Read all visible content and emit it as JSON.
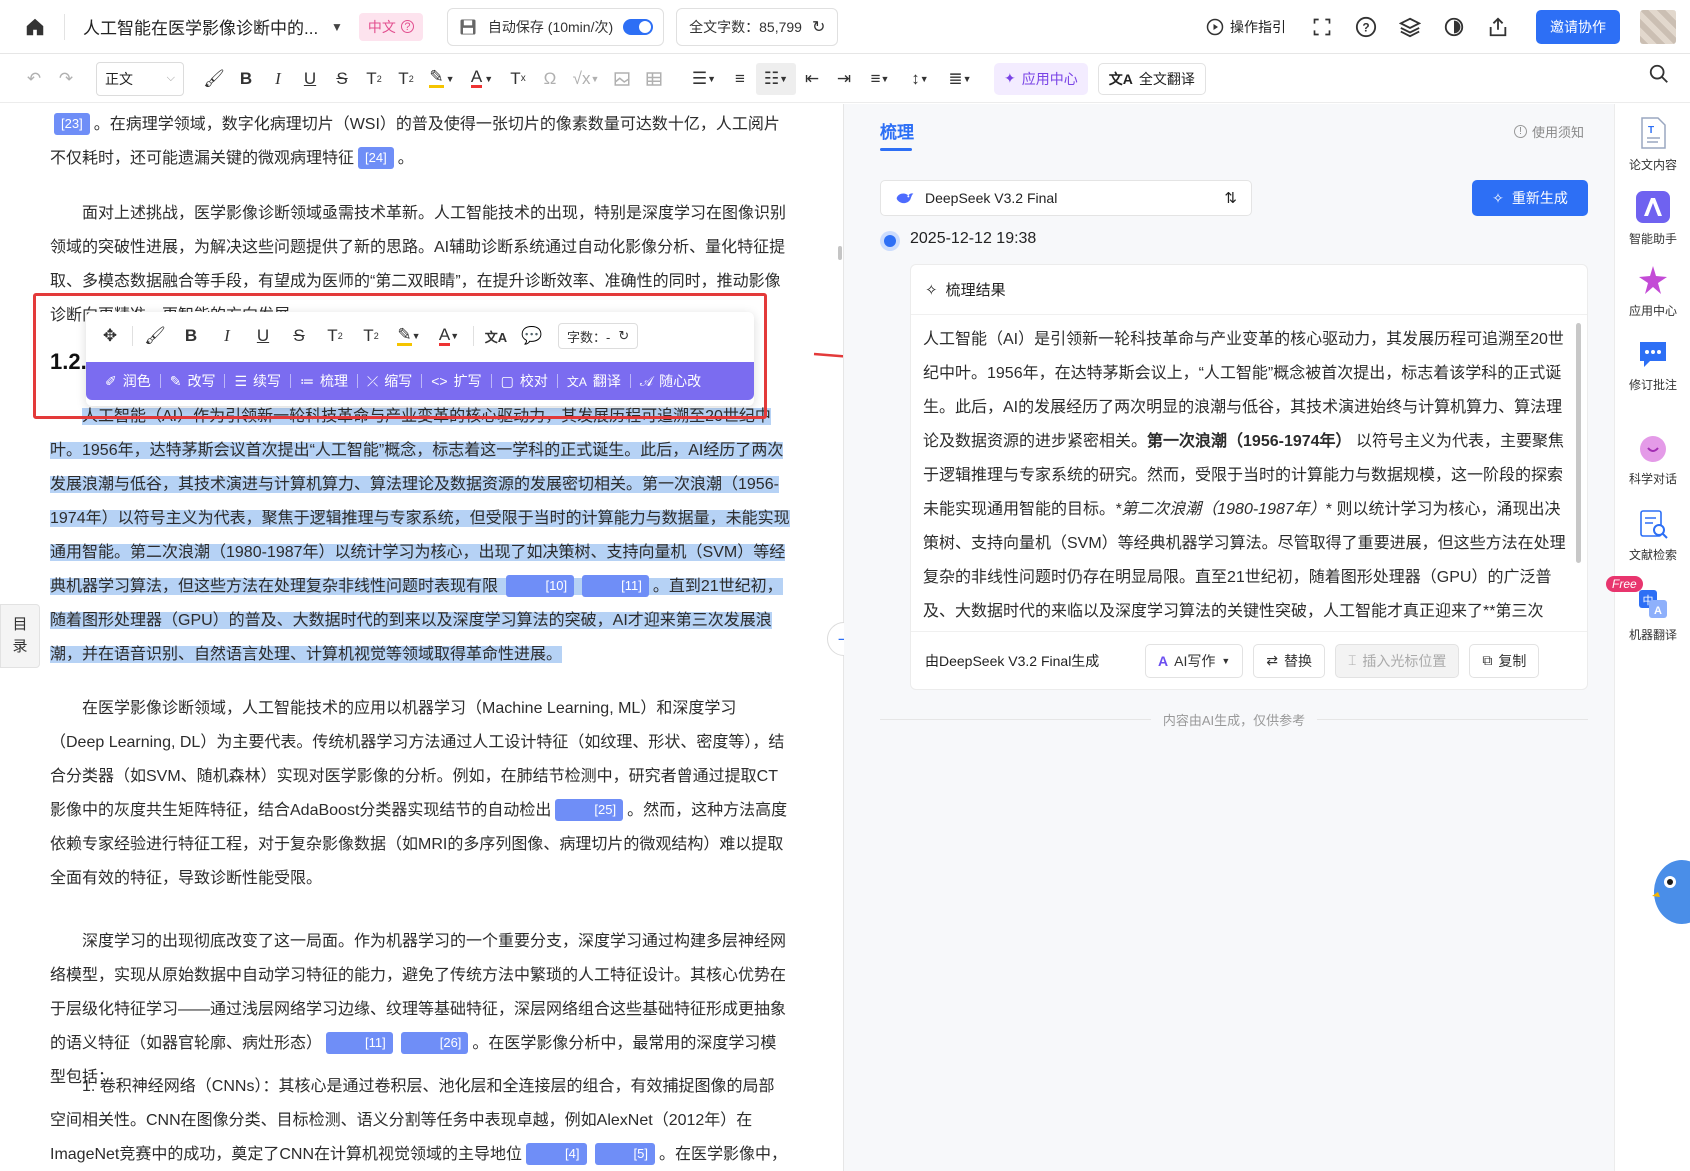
{
  "app": {
    "doc_title": "人工智能在医学影像诊断中的...",
    "lang_badge": "中文",
    "autosave_label": "自动保存 (10min/次)",
    "word_count": "全文字数：85,799",
    "guide": "操作指引",
    "invite": "邀请协作"
  },
  "toolbar": {
    "style_select": "正文",
    "app_center": "应用中心",
    "full_translate": "全文翻译"
  },
  "float_toolbar": {
    "count_label": "字数：-",
    "actions": [
      "润色",
      "改写",
      "续写",
      "梳理",
      "缩写",
      "扩写",
      "校对",
      "翻译",
      "随心改"
    ]
  },
  "editor": {
    "toc": [
      "目",
      "录"
    ],
    "p1": {
      "a": "。在病理学领域，数字化病理切片（WSI）的普及使得一张切片的像素数量可达数十亿，人工阅片不仅耗时，还可能遗漏关键的微观病理特征",
      "b": "。",
      "c1": "[23]",
      "c2": "[24]"
    },
    "p2": "面对上述挑战，医学影像诊断领域亟需技术革新。人工智能技术的出现，特别是深度学习在图像识别领域的突破性进展，为解决这些问题提供了新的思路。AI辅助诊断系统通过自动化影像分析、量化特征提取、多模态数据融合等手段，有望成为医师的“第二双眼睛”，在提升诊断效率、准确性的同时，推动影像诊断向更精准、更智能的方向发展。",
    "heading": "1.2.",
    "p3": {
      "a": "人工智能（AI）作为引领新一轮科技革命与产业变革的核心驱动力，其发展历程可追溯至20世纪中叶。1956年，达特茅斯会议首次提出“人工智能”概念，标志着这一学科的正式诞生。此后，AI经历了两次发展浪潮与低谷，其技术演进与计算机算力、算法理论及数据资源的发展密切相关。第一次浪潮（1956-1974年）以符号主义为代表，聚焦于逻辑推理与专家系统，但受限于当时的计算能力与数据量，未能实现通用智能。第二次浪潮（1980-1987年）以统计学习为核心，出现了如决策树、支持向量机（SVM）等经典机器学习算法，但这些方法在处理复杂非线性问题时表现有限",
      "b": "。直到21世纪初，随着图形处理器（GPU）的普及、大数据时代的到来以及深度学习算法的突破，AI才迎来第三次发展浪潮，并在语音识别、自然语言处理、计算机视觉等领域取得革命性进展。",
      "c1": "[10]",
      "c2": "[11]"
    },
    "p4": {
      "a": "在医学影像诊断领域，人工智能技术的应用以机器学习（Machine Learning, ML）和深度学习（Deep Learning, DL）为主要代表。传统机器学习方法通过人工设计特征（如纹理、形状、密度等），结合分类器（如SVM、随机森林）实现对医学影像的分析。例如，在肺结节检测中，研究者曾通过提取CT影像中的灰度共生矩阵特征，结合AdaBoost分类器实现结节的自动检出",
      "b": "。然而，这种方法高度依赖专家经验进行特征工程，对于复杂影像数据（如MRI的多序列图像、病理切片的微观结构）难以提取全面有效的特征，导致诊断性能受限。",
      "c1": "[25]"
    },
    "p5": {
      "a": "深度学习的出现彻底改变了这一局面。作为机器学习的一个重要分支，深度学习通过构建多层神经网络模型，实现从原始数据中自动学习特征的能力，避免了传统方法中繁琐的人工特征设计。其核心优势在于层级化特征学习——通过浅层网络学习边缘、纹理等基础特征，深层网络组合这些基础特征形成更抽象的语义特征（如器官轮廓、病灶形态）",
      "b": "。在医学影像分析中，最常用的深度学习模型包括：",
      "c1": "[11]",
      "c2": "[26]"
    },
    "p6": {
      "a": "1. 卷积神经网络（CNNs）：其核心是通过卷积层、池化层和全连接层的组合，有效捕捉图像的局部空间相关性。CNN在图像分类、目标检测、语义分割等任务中表现卓越，例如AlexNet（2012年）在ImageNet竞赛中的成功，奠定了CNN在计算机视觉领域的主导地位",
      "b": "。在医学影像中，CNN被",
      "c1": "[4]",
      "c2": "[5]"
    }
  },
  "panel": {
    "tab": "梳理",
    "usage": "使用须知",
    "model": "DeepSeek V3.2 Final",
    "regenerate": "重新生成",
    "timestamp": "2025-12-12 19:38",
    "result_title": "梳理结果",
    "result": {
      "t1": "人工智能（AI）是引领新一轮科技革命与产业变革的核心驱动力，其发展历程可追溯至20世纪中叶。1956年，在达特茅斯会议上，“人工智能”概念被首次提出，标志着该学科的正式诞生。此后，AI的发展经历了两次明显的浪潮与低谷，其技术演进始终与计算机算力、算法理论及数据资源的进步紧密相关。",
      "b1": "第一次浪潮（1956-1974年）",
      "t2": " 以符号主义为代表，主要聚焦于逻辑推理与专家系统的研究。然而，受限于当时的计算能力与数据规模，这一阶段的探索未能实现通用智能的目标。",
      "i1": "*第二次浪潮（1980-1987年）",
      "t3": "* 则以统计学习为核心，涌现出决策树、支持向量机（SVM）等经典机器学习算法。尽管取得了重要进展，但这些方法在处理复杂的非线性问题时仍存在明显局限。直至21世纪初，随着图形处理器（GPU）的广泛普及、大数据时代的来临以及深度学习算法的关键性突破，人工智能才真正迎来了**第三次"
    },
    "generated_by": "由DeepSeek V3.2 Final生成",
    "ai_write": "AI写作",
    "replace": "替换",
    "insert_cursor": "插入光标位置",
    "copy": "复制",
    "note": "内容由AI生成，仅供参考"
  },
  "rail": [
    "论文内容",
    "智能助手",
    "应用中心",
    "修订批注",
    "科学对话",
    "文献检索",
    "机器翻译"
  ],
  "rail_free": "Free",
  "colors": {
    "accent": "#2d6ff5",
    "selection": "#b6d2f5",
    "ai_bar": "#7b6cf0",
    "annotation": "#e33a3a"
  }
}
